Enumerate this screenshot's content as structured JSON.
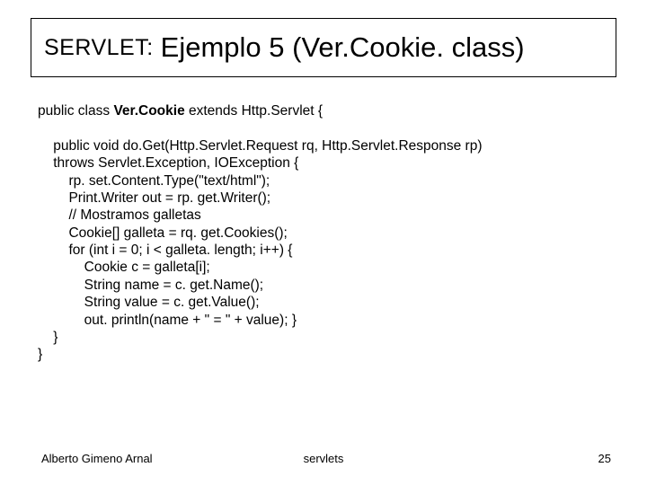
{
  "title": {
    "label": "SERVLET:",
    "main": "Ejemplo 5 (Ver.Cookie. class)"
  },
  "code": {
    "decl_prefix": "public class ",
    "decl_name": "Ver.Cookie",
    "decl_suffix": " extends Http.Servlet {",
    "lines": [
      "",
      "    public void do.Get(Http.Servlet.Request rq, Http.Servlet.Response rp)",
      "    throws Servlet.Exception, IOException {",
      "        rp. set.Content.Type(\"text/html\");",
      "        Print.Writer out = rp. get.Writer();",
      "        // Mostramos galletas",
      "        Cookie[] galleta = rq. get.Cookies();",
      "        for (int i = 0; i < galleta. length; i++) {",
      "            Cookie c = galleta[i];",
      "            String name = c. get.Name();",
      "            String value = c. get.Value();",
      "            out. println(name + \" = \" + value); }",
      "    }",
      "}"
    ]
  },
  "footer": {
    "author": "Alberto Gimeno Arnal",
    "center": "servlets",
    "page": "25"
  }
}
